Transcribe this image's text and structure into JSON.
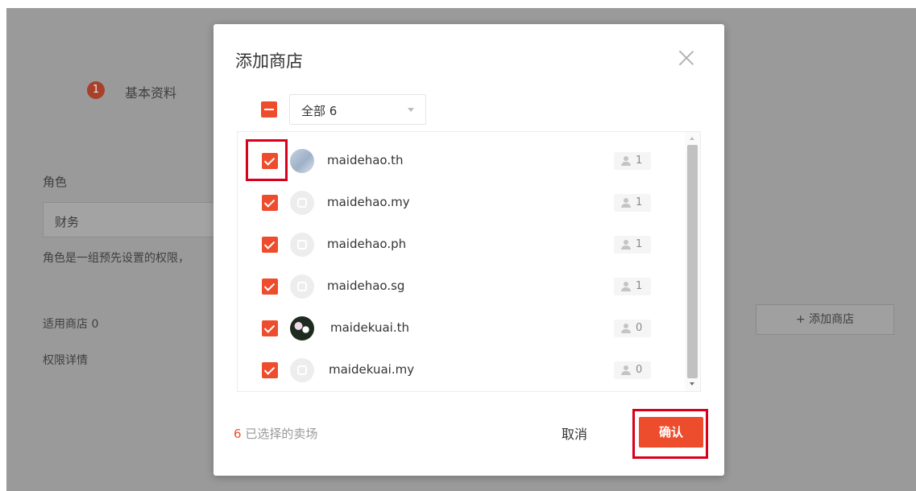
{
  "background": {
    "step": {
      "number": "1",
      "label": "基本资料"
    },
    "role_label": "角色",
    "role_value": "财务",
    "role_hint": "角色是一组预先设置的权限，",
    "applicable_shops": "适用商店 0",
    "permission_details": "权限详情",
    "add_shop_button": "+ 添加商店"
  },
  "modal": {
    "title": "添加商店",
    "filter": {
      "selected": "全部 6"
    },
    "shops": [
      {
        "name": "maidehao.th",
        "avatar": "shirt-photo",
        "members": "1"
      },
      {
        "name": "maidehao.my",
        "avatar": "default",
        "members": "1"
      },
      {
        "name": "maidehao.ph",
        "avatar": "default",
        "members": "1"
      },
      {
        "name": "maidehao.sg",
        "avatar": "default",
        "members": "1"
      },
      {
        "name": "maidekuai.th",
        "avatar": "flower-photo",
        "members": "0"
      },
      {
        "name": "maidekuai.my",
        "avatar": "default",
        "members": "0"
      }
    ],
    "selected_count": "6",
    "selected_suffix": "已选择的卖场",
    "cancel_label": "取消",
    "confirm_label": "确认"
  },
  "colors": {
    "accent": "#ee4d2d",
    "highlight": "#d9001b"
  }
}
